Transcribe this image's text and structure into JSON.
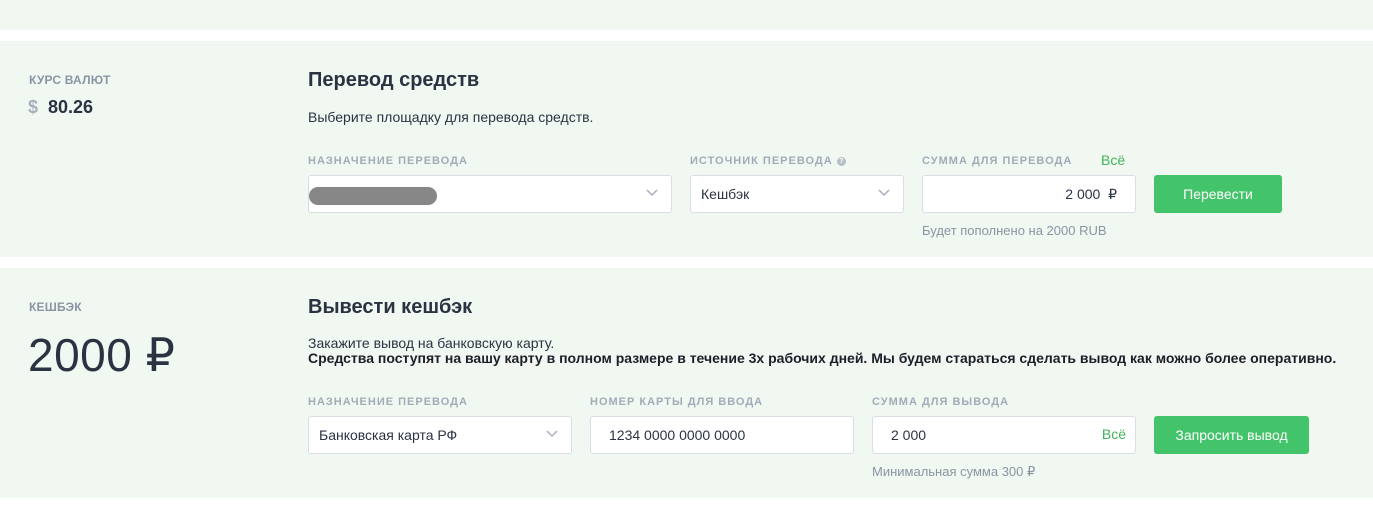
{
  "rate": {
    "label": "КУРС ВАЛЮТ",
    "currency_symbol": "$",
    "value": "80.26"
  },
  "transfer": {
    "title": "Перевод средств",
    "description": "Выберите площадку для перевода средств.",
    "destination": {
      "label": "НАЗНАЧЕНИЕ ПЕРЕВОДА"
    },
    "source": {
      "label": "ИСТОЧНИК ПЕРЕВОДА",
      "help_icon": "question-icon",
      "value": "Кешбэк"
    },
    "amount": {
      "label": "СУММА ДЛЯ ПЕРЕВОДА",
      "all_link": "Всё",
      "value": "2 000  ₽",
      "hint": "Будет пополнено на 2000 RUB"
    },
    "submit_label": "Перевести"
  },
  "cashback": {
    "label": "КЕШБЭК",
    "amount": "2000 ₽",
    "title": "Вывести кешбэк",
    "description": "Закажите вывод на банковскую карту.",
    "description_bold": "Средства поступят на вашу карту в полном размере в течение 3х рабочих дней. Мы будем стараться сделать вывод как можно более оперативно.",
    "destination": {
      "label": "НАЗНАЧЕНИЕ ПЕРЕВОДА",
      "value": "Банковская карта РФ"
    },
    "card": {
      "label": "НОМЕР КАРТЫ ДЛЯ ВВОДА",
      "value": "1234 0000 0000 0000"
    },
    "amount_field": {
      "label": "СУММА ДЛЯ ВЫВОДА",
      "value": "2 000",
      "all_link": "Всё",
      "hint": "Минимальная сумма 300 ₽"
    },
    "submit_label": "Запросить вывод"
  },
  "colors": {
    "background_band": "#f1f8f1",
    "accent_green": "#43c46a",
    "text_dark": "#2b3343",
    "text_muted": "#a2abb8"
  }
}
